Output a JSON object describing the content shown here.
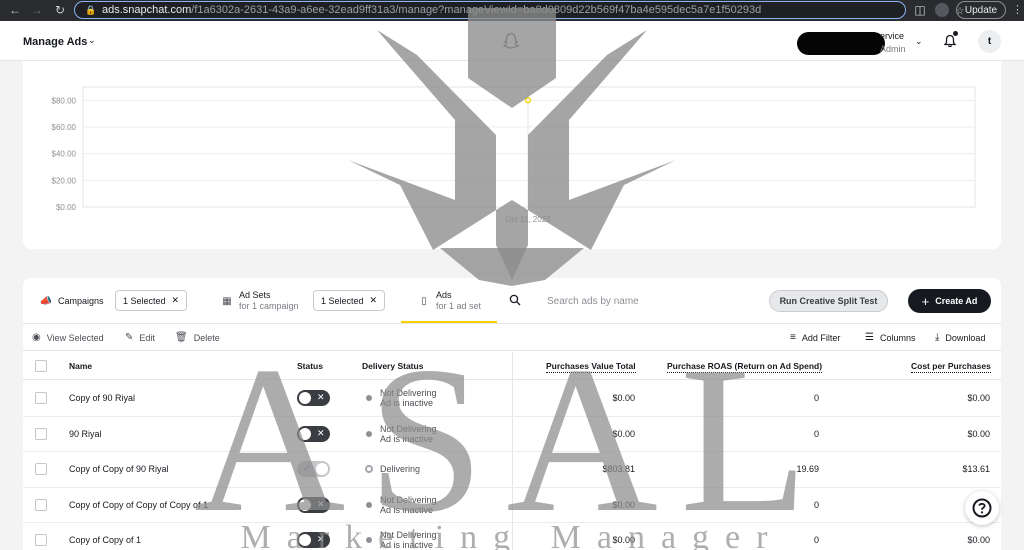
{
  "browser": {
    "url_host": "ads.snapchat.com",
    "url_path": "/f1a6302a-2631-43a9-a6ee-32ead9ff31a3/manage?manageViewId=ba8d0809d22b569f47ba4e595dec5a7e1f50293d",
    "update_label": "Update"
  },
  "header": {
    "title": "Manage Ads",
    "account_name": "ervice",
    "account_role": "Admin",
    "avatar_letter": "t"
  },
  "chart_data": {
    "type": "line",
    "ylabel": "",
    "yticks": [
      "$80.00",
      "$60.00",
      "$40.00",
      "$20.00",
      "$0.00"
    ],
    "ylim": [
      0,
      90
    ],
    "x": [
      "Oct 11, 2023"
    ],
    "series": [
      {
        "values": [
          80
        ]
      }
    ],
    "accent": "#f7d100"
  },
  "tabs": {
    "campaigns": {
      "label": "Campaigns",
      "chip": "1 Selected"
    },
    "adsets": {
      "label": "Ad Sets",
      "sub": "for 1 campaign",
      "chip": "1 Selected"
    },
    "ads": {
      "label": "Ads",
      "sub": "for 1 ad set"
    },
    "search_placeholder": "Search ads by name",
    "split_test": "Run Creative Split Test",
    "create_ad": "Create Ad"
  },
  "actions": {
    "view_selected": "View Selected",
    "edit": "Edit",
    "delete": "Delete",
    "add_filter": "Add Filter",
    "columns": "Columns",
    "download": "Download"
  },
  "table": {
    "headers": {
      "name": "Name",
      "status": "Status",
      "delivery": "Delivery Status",
      "purchases_value": "Purchases Value Total",
      "roas": "Purchase ROAS (Return on Ad Spend)",
      "cost": "Cost per Purchases"
    },
    "rows": [
      {
        "name": "Copy of 90 Riyal",
        "status_on": false,
        "delivery_1": "Not Delivering",
        "delivery_2": "Ad is inactive",
        "value": "$0.00",
        "roas": "0",
        "cost": "$0.00"
      },
      {
        "name": "90 Riyal",
        "status_on": false,
        "delivery_1": "Not Delivering",
        "delivery_2": "Ad is inactive",
        "value": "$0.00",
        "roas": "0",
        "cost": "$0.00"
      },
      {
        "name": "Copy of Copy of 90 Riyal",
        "status_on": true,
        "delivery_1": "Delivering",
        "delivery_2": "",
        "value": "$803.81",
        "roas": "19.69",
        "cost": "$13.61"
      },
      {
        "name": "Copy of Copy of Copy of Copy of 1",
        "status_on": false,
        "delivery_1": "Not Delivering",
        "delivery_2": "Ad is inactive",
        "value": "$0.00",
        "roas": "0",
        "cost": ""
      },
      {
        "name": "Copy of Copy of 1",
        "status_on": false,
        "delivery_1": "Not Delivering",
        "delivery_2": "Ad is inactive",
        "value": "$0.00",
        "roas": "0",
        "cost": "$0.00"
      }
    ]
  },
  "watermark": {
    "text": "ASAL",
    "subtitle": "Marketing Manager"
  }
}
